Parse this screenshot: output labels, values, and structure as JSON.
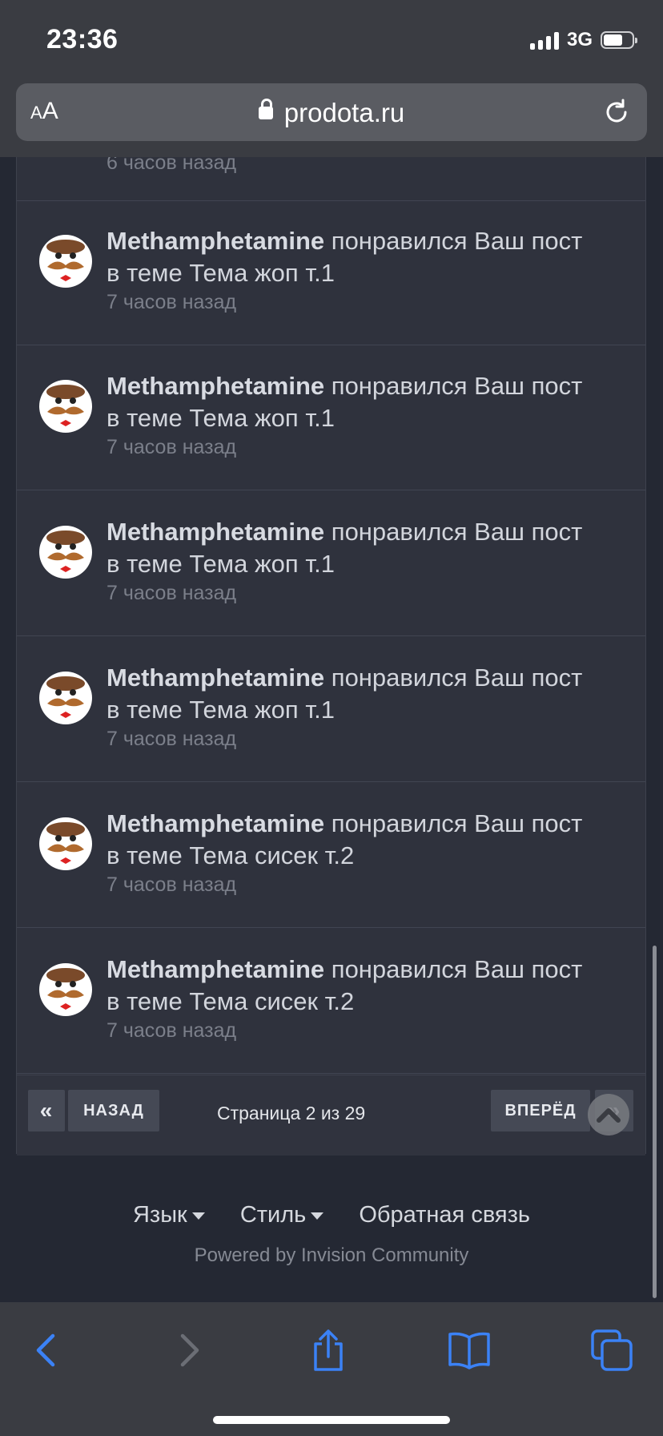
{
  "status_bar": {
    "time": "23:36",
    "network": "3G"
  },
  "browser": {
    "aa_small": "A",
    "aa_large": "A",
    "url": "prodota.ru"
  },
  "top_partial_time": "6 часов назад",
  "notifications": [
    {
      "user": "Methamphetamine",
      "action": " понравился Ваш пост",
      "topic_line": "в теме Тема жоп т.1",
      "time": "7 часов назад"
    },
    {
      "user": "Methamphetamine",
      "action": " понравился Ваш пост",
      "topic_line": "в теме Тема жоп т.1",
      "time": "7 часов назад"
    },
    {
      "user": "Methamphetamine",
      "action": " понравился Ваш пост",
      "topic_line": "в теме Тема жоп т.1",
      "time": "7 часов назад"
    },
    {
      "user": "Methamphetamine",
      "action": " понравился Ваш пост",
      "topic_line": "в теме Тема жоп т.1",
      "time": "7 часов назад"
    },
    {
      "user": "Methamphetamine",
      "action": " понравился Ваш пост",
      "topic_line": "в теме Тема сисек т.2",
      "time": "7 часов назад"
    },
    {
      "user": "Methamphetamine",
      "action": " понравился Ваш пост",
      "topic_line": "в теме Тема сисек т.2",
      "time": "7 часов назад"
    }
  ],
  "pager": {
    "first": "«",
    "prev": "НАЗАД",
    "info": "Страница 2 из 29",
    "next": "ВПЕРЁД",
    "last": "»"
  },
  "footer": {
    "language": "Язык",
    "style": "Стиль",
    "feedback": "Обратная связь",
    "powered": "Powered by Invision Community"
  },
  "colors": {
    "background": "#242833",
    "panel": "#2f323d",
    "browser_chrome": "#3a3c42",
    "accent_icons": "#3b82f6"
  }
}
